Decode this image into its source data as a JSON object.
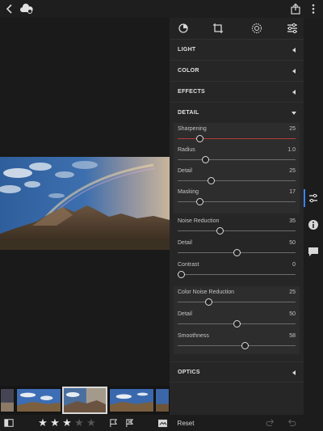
{
  "app": {
    "top_icons": [
      "back-chevron-icon",
      "cloud-sync-icon",
      "share-icon",
      "more-icon"
    ]
  },
  "toolbar": {
    "tools": [
      "presets-icon",
      "crop-icon",
      "selective-icon",
      "edit-icon"
    ]
  },
  "panel": {
    "sections": [
      {
        "label": "LIGHT",
        "state": "collapsed"
      },
      {
        "label": "COLOR",
        "state": "collapsed"
      },
      {
        "label": "EFFECTS",
        "state": "collapsed"
      },
      {
        "label": "DETAIL",
        "state": "expanded"
      },
      {
        "label": "OPTICS",
        "state": "collapsed"
      }
    ],
    "detail": {
      "sharpening": [
        {
          "label": "Sharpening",
          "value": "25",
          "fraction": 0.17,
          "accent": true
        },
        {
          "label": "Radius",
          "value": "1.0",
          "fraction": 0.22
        },
        {
          "label": "Detail",
          "value": "25",
          "fraction": 0.27
        },
        {
          "label": "Masking",
          "value": "17",
          "fraction": 0.17
        }
      ],
      "noise": [
        {
          "label": "Noise Reduction",
          "value": "35",
          "fraction": 0.35
        },
        {
          "label": "Detail",
          "value": "50",
          "fraction": 0.5
        },
        {
          "label": "Contrast",
          "value": "0",
          "fraction": 0.0
        }
      ],
      "color_noise": [
        {
          "label": "Color Noise Reduction",
          "value": "25",
          "fraction": 0.25
        },
        {
          "label": "Detail",
          "value": "50",
          "fraction": 0.5
        },
        {
          "label": "Smoothness",
          "value": "58",
          "fraction": 0.58
        }
      ]
    }
  },
  "rail": {
    "icons": [
      "adjustments-icon",
      "info-icon",
      "comment-icon"
    ]
  },
  "bottombar": {
    "rating": 3,
    "max_rating": 5,
    "reset_label": "Reset",
    "icons": [
      "compare-icon",
      "pick-flag-icon",
      "reject-flag-icon",
      "filmstrip-toggle-icon",
      "redo-icon",
      "undo-icon"
    ]
  },
  "colors": {
    "accent_blue": "#3b82f6",
    "sharpening_track": "#b83a3a",
    "panel_bg": "#262626"
  }
}
